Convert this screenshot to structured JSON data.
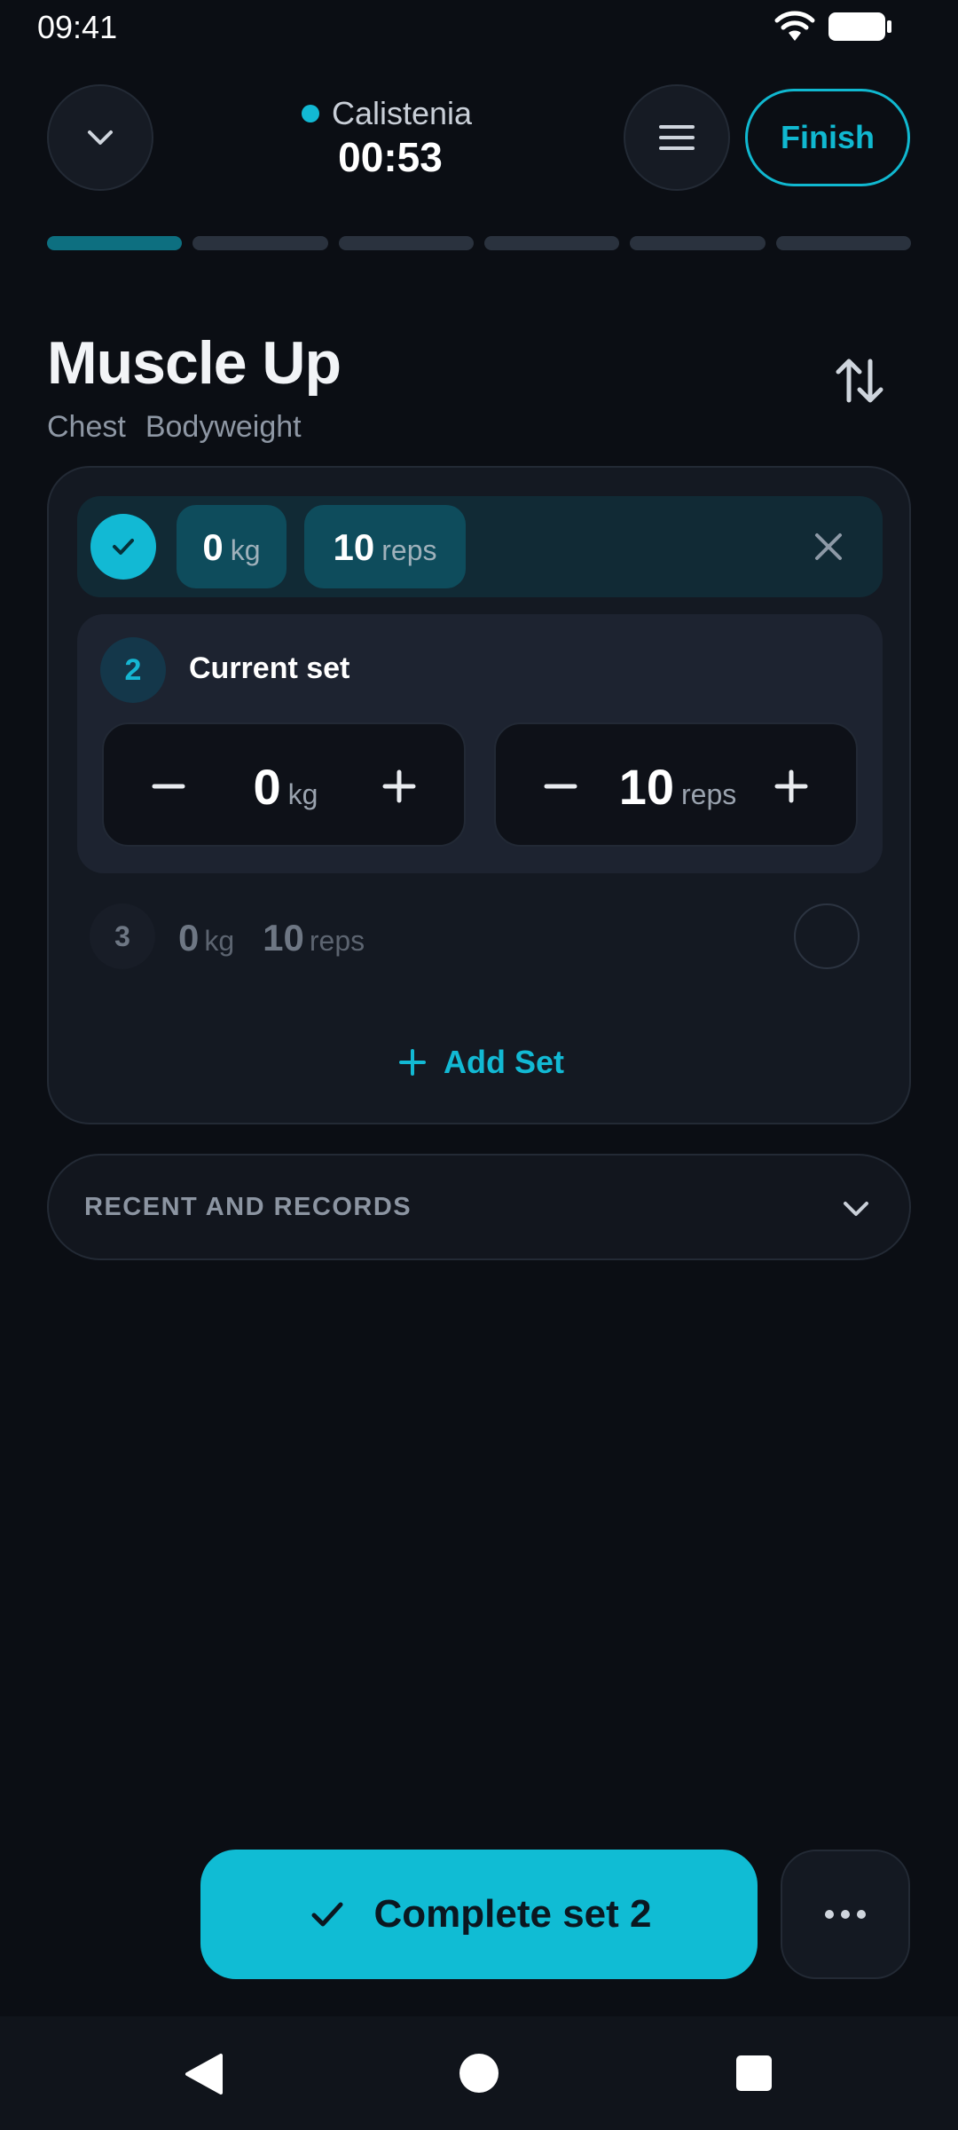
{
  "status_bar": {
    "time": "09:41"
  },
  "header": {
    "workout_name": "Calistenia",
    "timer": "00:53",
    "finish_label": "Finish"
  },
  "progress": {
    "total_segments": 6,
    "completed_segments": 1
  },
  "exercise": {
    "title": "Muscle Up",
    "tags": [
      "Chest",
      "Bodyweight"
    ]
  },
  "sets": {
    "completed": {
      "weight": "0",
      "weight_unit": "kg",
      "reps": "10",
      "reps_unit": "reps"
    },
    "current": {
      "number": "2",
      "label": "Current set",
      "weight": "0",
      "weight_unit": "kg",
      "reps": "10",
      "reps_unit": "reps"
    },
    "pending": {
      "number": "3",
      "weight": "0",
      "weight_unit": "kg",
      "reps": "10",
      "reps_unit": "reps"
    },
    "add_set_label": "Add Set"
  },
  "records": {
    "label": "RECENT AND RECORDS"
  },
  "actions": {
    "complete_label": "Complete set 2"
  },
  "colors": {
    "accent": "#12b9d4",
    "background": "#0b0e14",
    "card": "#141922"
  }
}
